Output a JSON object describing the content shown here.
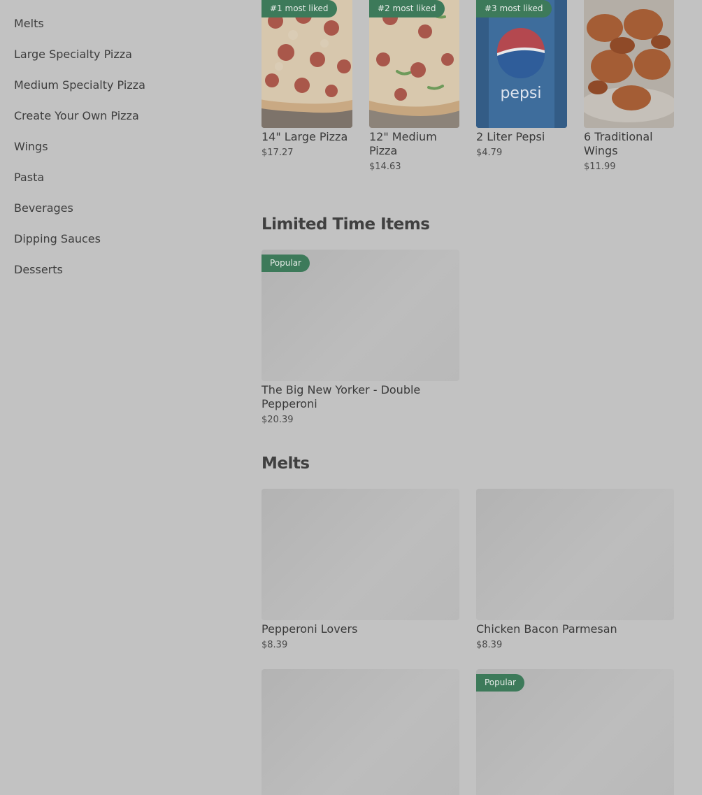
{
  "sidebar": {
    "items": [
      {
        "label": "Melts"
      },
      {
        "label": "Large Specialty Pizza"
      },
      {
        "label": "Medium Specialty Pizza"
      },
      {
        "label": "Create Your Own Pizza"
      },
      {
        "label": "Wings"
      },
      {
        "label": "Pasta"
      },
      {
        "label": "Beverages"
      },
      {
        "label": "Dipping Sauces"
      },
      {
        "label": "Desserts"
      }
    ]
  },
  "most_liked": {
    "items": [
      {
        "badge": "#1 most liked",
        "name": "14\" Large Pizza",
        "price": "$17.27",
        "image": "pepperoni-pizza"
      },
      {
        "badge": "#2 most liked",
        "name": "12\" Medium Pizza",
        "price": "$14.63",
        "image": "pepper-pizza"
      },
      {
        "badge": "#3 most liked",
        "name": "2 Liter Pepsi",
        "price": "$4.79",
        "image": "pepsi-bottle"
      },
      {
        "badge": "",
        "name": "6 Traditional Wings",
        "price": "$11.99",
        "image": "chicken-wings"
      }
    ]
  },
  "limited_time": {
    "title": "Limited Time Items",
    "items": [
      {
        "badge": "Popular",
        "name": "The Big New Yorker - Double Pepperoni",
        "price": "$20.39"
      }
    ]
  },
  "melts": {
    "title": "Melts",
    "items": [
      {
        "badge": "",
        "name": "Pepperoni Lovers",
        "price": "$8.39"
      },
      {
        "badge": "",
        "name": "Chicken Bacon Parmesan",
        "price": "$8.39"
      },
      {
        "badge": "",
        "name": "",
        "price": ""
      },
      {
        "badge": "Popular",
        "name": "",
        "price": ""
      }
    ]
  },
  "colors": {
    "overlay_bg": "#c2c2c2",
    "badge_bg": "#3d7a5a",
    "badge_text": "#e6ece8"
  }
}
